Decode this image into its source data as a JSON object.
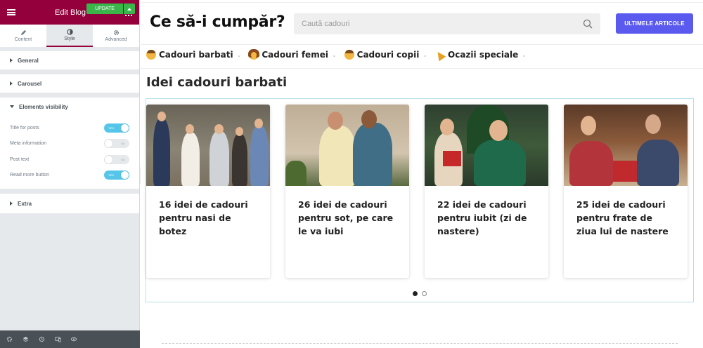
{
  "editor": {
    "title": "Edit Blog",
    "tabs": [
      {
        "label": "Content",
        "icon": "pencil-icon"
      },
      {
        "label": "Style",
        "icon": "half-circle-icon"
      },
      {
        "label": "Advanced",
        "icon": "gear-icon"
      }
    ],
    "sections": {
      "general": "General",
      "carousel": "Carousel",
      "visibility": "Elements visibility",
      "extra": "Extra"
    },
    "controls": [
      {
        "label": "Title for posts",
        "state": "YES",
        "on": true
      },
      {
        "label": "Meta information",
        "state": "NO",
        "on": false
      },
      {
        "label": "Post text",
        "state": "NO",
        "on": false
      },
      {
        "label": "Read more button",
        "state": "YES",
        "on": true
      }
    ],
    "update_label": "UPDATE",
    "accent": "#93003c"
  },
  "site": {
    "logo": "Ce să-i cumpăr?",
    "search_placeholder": "Caută cadouri",
    "cta": "ULTIMELE ARTICOLE",
    "cta_color": "#5a5aef",
    "nav": [
      {
        "label": "Cadouri barbati",
        "icon": "man-emoji-icon"
      },
      {
        "label": "Cadouri femei",
        "icon": "woman-emoji-icon"
      },
      {
        "label": "Cadouri copii",
        "icon": "child-emoji-icon"
      },
      {
        "label": "Ocazii speciale",
        "icon": "party-popper-icon"
      }
    ],
    "heading": "Idei cadouri barbati",
    "posts": [
      {
        "title": "16 idei de cadouri pentru nasi de botez"
      },
      {
        "title": "26 idei de cadouri pentru sot, pe care le va iubi"
      },
      {
        "title": "22 idei de cadouri pentru iubit (zi de nastere)"
      },
      {
        "title": "25 idei de cadouri pentru frate de ziua lui de nastere"
      }
    ],
    "carousel_pages": 2,
    "carousel_active": 1
  }
}
